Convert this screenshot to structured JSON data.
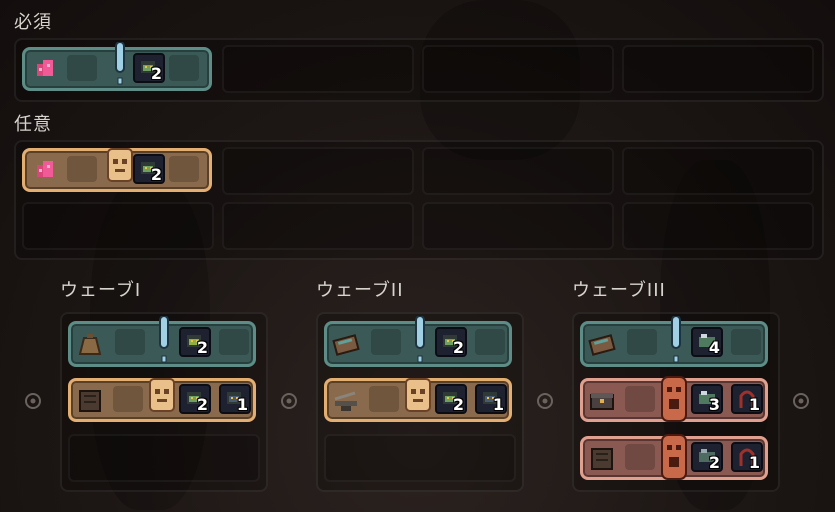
{
  "sections": {
    "required_label": "必須",
    "optional_label": "任意"
  },
  "required_card": {
    "count": "2"
  },
  "optional_card": {
    "count": "2"
  },
  "waves": [
    {
      "title": "ウェーブI",
      "top": {
        "count": "2"
      },
      "bottom": {
        "counts": [
          "2",
          "1"
        ]
      }
    },
    {
      "title": "ウェーブII",
      "top": {
        "count": "2"
      },
      "bottom": {
        "counts": [
          "2",
          "1"
        ]
      }
    },
    {
      "title": "ウェーブIII",
      "top": {
        "count": "4"
      },
      "middle": {
        "counts": [
          "3",
          "1"
        ]
      },
      "bottom": {
        "counts": [
          "2",
          "1"
        ]
      }
    }
  ],
  "colors": {
    "teal_border": "#5e8d87",
    "gold_border": "#e3ae72",
    "rose_border": "#e0a08f",
    "background": "#1c1614"
  },
  "icons": [
    "pink-gem-icon",
    "goblin-icon",
    "exclamation-pin-icon",
    "skull-mask-icon",
    "loot-bag-icon",
    "chest-icon",
    "anvil-icon",
    "wood-crate-icon",
    "hooded-rogue-icon",
    "settings-ring-icon"
  ]
}
